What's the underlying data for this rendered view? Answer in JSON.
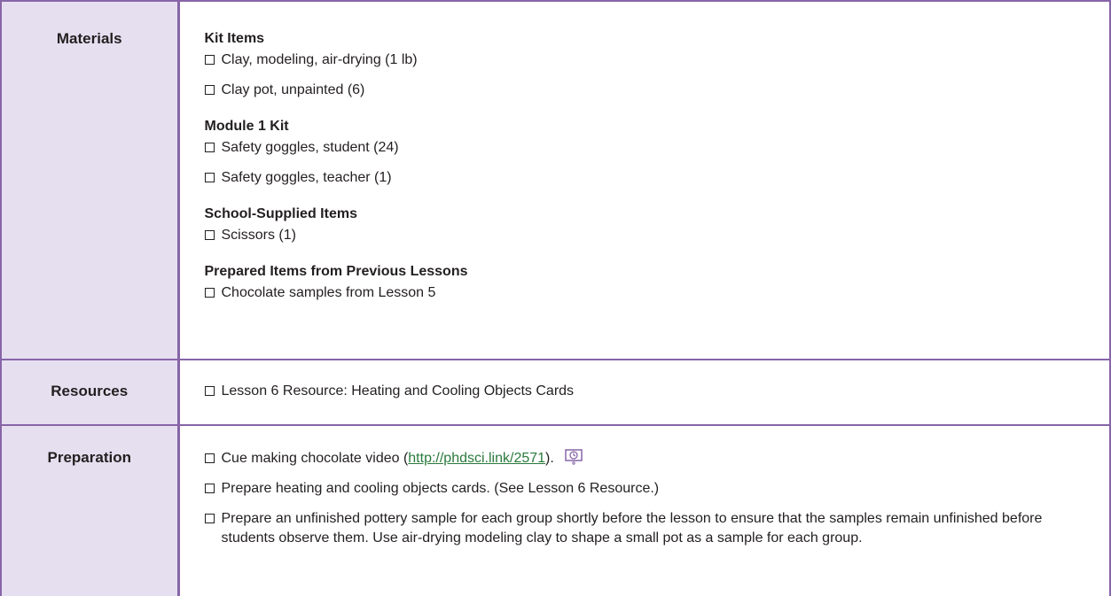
{
  "materials": {
    "heading": "Materials",
    "groups": [
      {
        "title": "Kit Items",
        "items": [
          "Clay, modeling, air-drying (1 lb)",
          "Clay pot, unpainted (6)"
        ]
      },
      {
        "title": "Module 1 Kit",
        "items": [
          "Safety goggles, student (24)",
          "Safety goggles, teacher (1)"
        ]
      },
      {
        "title": "School-Supplied Items",
        "items": [
          "Scissors (1)"
        ]
      },
      {
        "title": "Prepared Items from Previous Lessons",
        "items": [
          "Chocolate samples from Lesson 5"
        ]
      }
    ]
  },
  "resources": {
    "heading": "Resources",
    "items": [
      "Lesson 6 Resource: Heating and Cooling Objects Cards"
    ]
  },
  "preparation": {
    "heading": "Preparation",
    "item1_prefix": "Cue making chocolate video (",
    "item1_link": "http://phdsci.link/2571",
    "item1_suffix": ").",
    "item1_icon": "video-icon",
    "item2": "Prepare heating and cooling objects cards. (See Lesson 6 Resource.)",
    "item3": "Prepare an unfinished pottery sample for each group shortly before the lesson to ensure that the samples remain unfinished before students observe them. Use air-drying modeling clay to shape a small pot as a sample for each group."
  },
  "colors": {
    "accent": "#8765a8",
    "header_fill": "#e6dff0",
    "link": "#2a7a3c"
  }
}
